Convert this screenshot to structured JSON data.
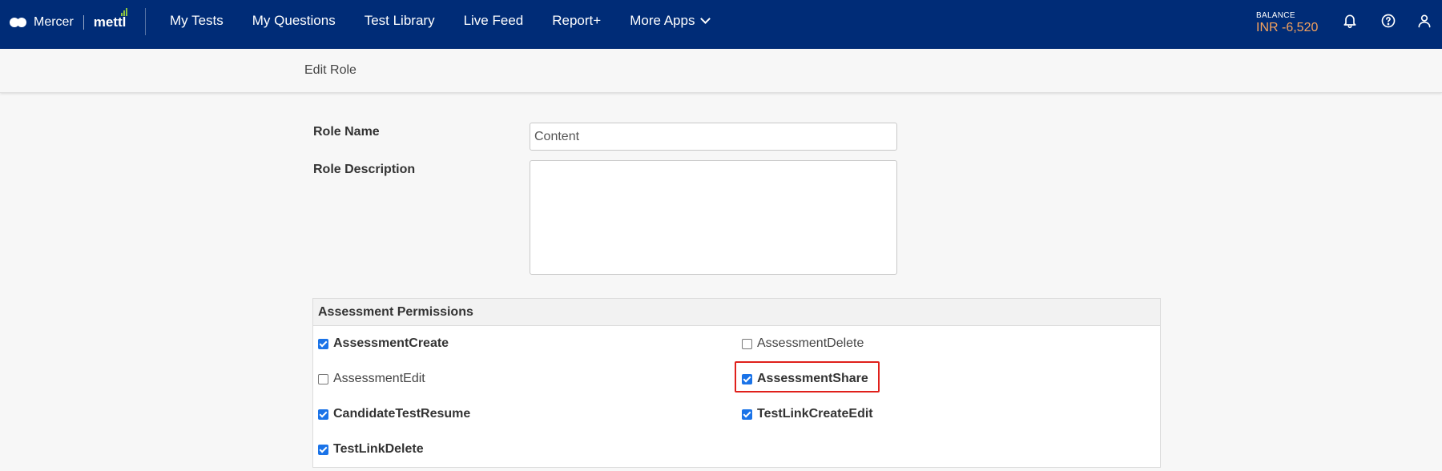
{
  "header": {
    "brand": "Mercer",
    "product": "mettl",
    "nav": [
      {
        "label": "My Tests"
      },
      {
        "label": "My Questions"
      },
      {
        "label": "Test Library"
      },
      {
        "label": "Live Feed"
      },
      {
        "label": "Report+"
      },
      {
        "label": "More Apps"
      }
    ],
    "balance_label": "BALANCE",
    "balance_value": "INR -6,520",
    "icons": [
      "bell-icon",
      "help-icon",
      "user-icon"
    ],
    "bg_color": "#002c77",
    "balance_color": "#f5a25d"
  },
  "page": {
    "title": "Edit Role"
  },
  "form": {
    "role_name_label": "Role Name",
    "role_name_value": "Content",
    "role_description_label": "Role Description",
    "role_description_value": ""
  },
  "permissions": {
    "title": "Assessment Permissions",
    "items": [
      {
        "label": "AssessmentCreate",
        "checked": true
      },
      {
        "label": "AssessmentDelete",
        "checked": false
      },
      {
        "label": "AssessmentEdit",
        "checked": false
      },
      {
        "label": "AssessmentShare",
        "checked": true,
        "highlighted": true
      },
      {
        "label": "CandidateTestResume",
        "checked": true
      },
      {
        "label": "TestLinkCreateEdit",
        "checked": true
      },
      {
        "label": "TestLinkDelete",
        "checked": true
      }
    ]
  }
}
